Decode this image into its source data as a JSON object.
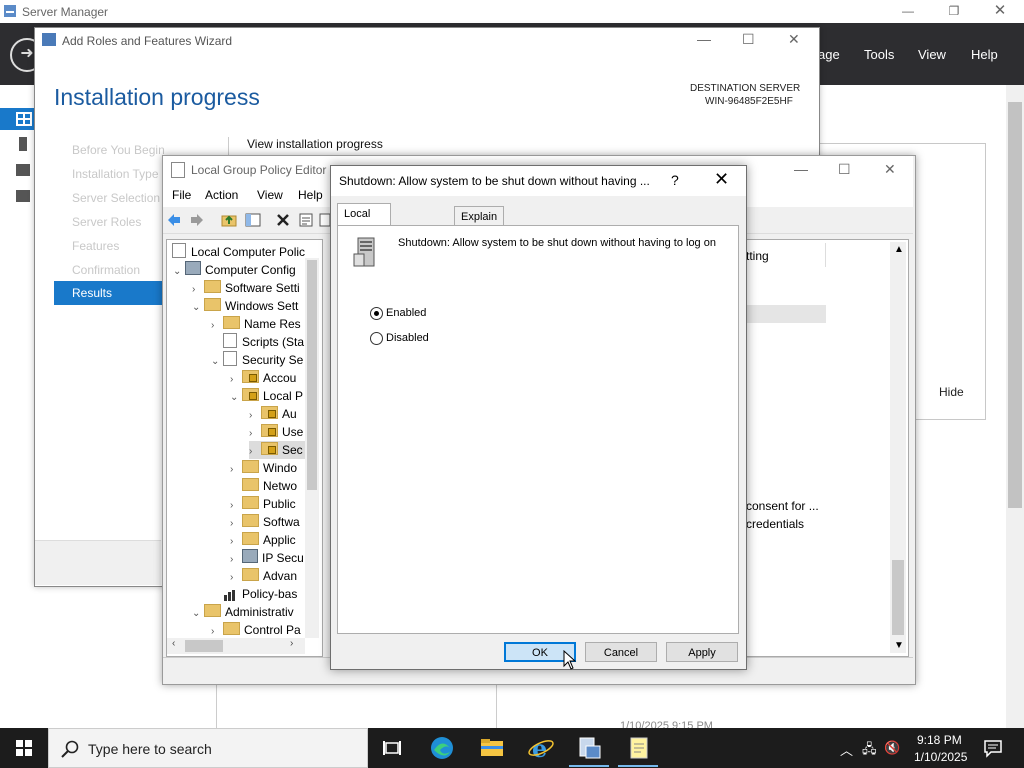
{
  "server_manager": {
    "title": "Server Manager",
    "menu": [
      "Manage",
      "Tools",
      "View",
      "Help"
    ],
    "menu_partial": "age",
    "hide_label": "Hide",
    "timestamp": "1/10/2025 9:15 PM"
  },
  "wizard": {
    "title": "Add Roles and Features Wizard",
    "heading": "Installation progress",
    "destination_label": "DESTINATION SERVER",
    "destination_server": "WIN-96485F2E5HF",
    "steps": [
      "Before You Begin",
      "Installation Type",
      "Server Selection",
      "Server Roles",
      "Features",
      "Confirmation"
    ],
    "current_step": "Results",
    "view_progress": "View installation progress"
  },
  "gpe": {
    "title": "Local Group Policy Editor",
    "menu": [
      "File",
      "Action",
      "View",
      "Help"
    ],
    "tree": [
      "Local Computer Polic",
      "Computer Config",
      "Software Setti",
      "Windows Sett",
      "Name Res",
      "Scripts (Sta",
      "Security Se",
      "Accou",
      "Local P",
      "Au",
      "Use",
      "Sec",
      "Windo",
      "Netwo",
      "Public",
      "Softwa",
      "Applic",
      "IP Secu",
      "Advan",
      "Policy-bas",
      "Administrativ",
      "Control Pa"
    ],
    "list_header_partial": "tting",
    "list_rows": [
      "consent for ...",
      "credentials"
    ]
  },
  "dialog": {
    "title": "Shutdown: Allow system to be shut down without having ...",
    "help": "?",
    "close": "✕",
    "tabs": [
      "Local Security Setting",
      "Explain"
    ],
    "policy_name": "Shutdown: Allow system to be shut down without having to log on",
    "options": [
      "Enabled",
      "Disabled"
    ],
    "selected": "Enabled",
    "buttons": {
      "ok": "OK",
      "cancel": "Cancel",
      "apply": "Apply"
    }
  },
  "taskbar": {
    "search_placeholder": "Type here to search",
    "time": "9:18 PM",
    "date": "1/10/2025"
  },
  "colors": {
    "accent": "#1979ca",
    "title_blue": "#1b5ba0",
    "sm_bar": "#2d2d30",
    "taskbar": "#1c1c1c"
  }
}
